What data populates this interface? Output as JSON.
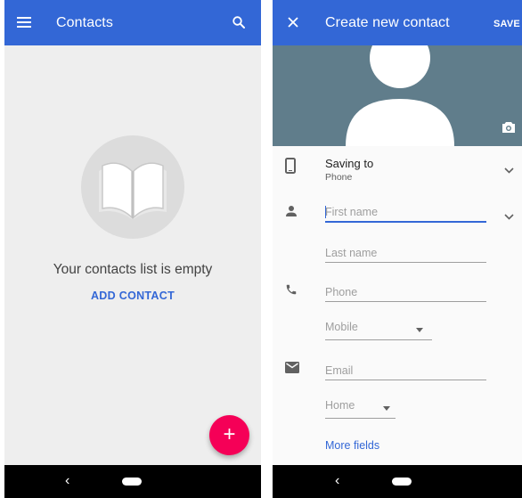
{
  "left_screen": {
    "app_bar": {
      "title": "Contacts",
      "menu_icon": "hamburger-menu-icon",
      "search_icon": "search-icon"
    },
    "empty_state": {
      "illustration": "open-book-icon",
      "message": "Your contacts list is empty",
      "add_contact_label": "ADD CONTACT"
    },
    "fab": {
      "label": "+",
      "icon": "add-icon"
    },
    "nav_bar": {
      "back": "‹",
      "home": "home-pill"
    }
  },
  "right_screen": {
    "app_bar": {
      "title": "Create new contact",
      "close_icon": "close-icon",
      "save_label": "SAVE"
    },
    "photo": {
      "placeholder_icon": "person-silhouette",
      "camera_icon": "camera-icon"
    },
    "saving_to": {
      "label": "Saving to",
      "value": "Phone",
      "icon": "phone-device-icon"
    },
    "name": {
      "icon": "person-icon",
      "first_name_placeholder": "First name",
      "last_name_placeholder": "Last name",
      "first_name_value": "",
      "last_name_value": ""
    },
    "phone": {
      "icon": "phone-icon",
      "placeholder": "Phone",
      "value": "",
      "type_selected": "Mobile"
    },
    "email": {
      "icon": "email-icon",
      "placeholder": "Email",
      "value": "",
      "type_selected": "Home"
    },
    "more_fields_label": "More fields",
    "nav_bar": {
      "back": "‹",
      "home": "home-pill"
    }
  },
  "colors": {
    "primary": "#3367d6",
    "accent": "#f50057",
    "photo_bg": "#607d8b",
    "nav_bar": "#000000"
  }
}
